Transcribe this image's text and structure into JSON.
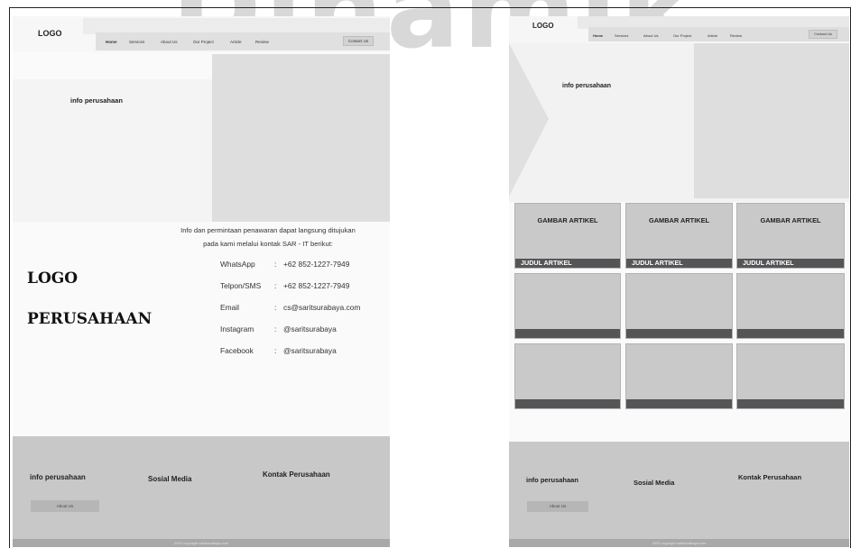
{
  "watermark": "Dinamik",
  "desktop": {
    "logo": "LOGO",
    "nav": [
      "Home",
      "Services",
      "About Us",
      "Our Project",
      "Article",
      "Review"
    ],
    "contact_button": "Contact Us",
    "hero_title": "info perusahaan",
    "contact_intro_line1": "Info dan permintaan penawaran dapat langsung ditujukan",
    "contact_intro_line2": "pada kami melalui kontak SAR - IT berikut:",
    "contacts": [
      {
        "label": "WhatsApp",
        "sep": ":",
        "value": "+62 852-1227-7949"
      },
      {
        "label": "Telpon/SMS",
        "sep": ":",
        "value": "+62 852-1227-7949"
      },
      {
        "label": "Email",
        "sep": ":",
        "value": "cs@saritsurabaya.com"
      },
      {
        "label": "Instagram",
        "sep": ":",
        "value": "@saritsurabaya"
      },
      {
        "label": "Facebook",
        "sep": ":",
        "value": "@saritsurabaya"
      }
    ],
    "company_logo_line1": "LOGO",
    "company_logo_line2": "PERUSAHAAN",
    "footer": {
      "col1": "info perusahaan",
      "col2": "Sosial Media",
      "col3": "Kontak Perusahaan",
      "button": "About Us",
      "copyright": "2022 copyright saritsurabaya.com"
    }
  },
  "articles_page": {
    "logo": "LOGO",
    "nav": [
      "Home",
      "Services",
      "About Us",
      "Our Project",
      "Article",
      "Review"
    ],
    "contact_button": "Contact Us",
    "hero_title": "info perusahaan",
    "cards": [
      {
        "image": "GAMBAR ARTIKEL",
        "title": "JUDUL ARTIKEL"
      },
      {
        "image": "GAMBAR ARTIKEL",
        "title": "JUDUL ARTIKEL"
      },
      {
        "image": "GAMBAR ARTIKEL",
        "title": "JUDUL ARTIKEL"
      },
      {
        "image": "",
        "title": ""
      },
      {
        "image": "",
        "title": ""
      },
      {
        "image": "",
        "title": ""
      },
      {
        "image": "",
        "title": ""
      },
      {
        "image": "",
        "title": ""
      },
      {
        "image": "",
        "title": ""
      }
    ],
    "footer": {
      "col1": "info perusahaan",
      "col2": "Sosial Media",
      "col3": "Kontak Perusahaan",
      "button": "About Us",
      "copyright": "2022 copyright saritsurabaya.com"
    }
  },
  "colors": {
    "footer": "#c8c8c8",
    "card": "#c9c9c9",
    "card_bar": "#555558",
    "hero_image": "#dedede"
  }
}
